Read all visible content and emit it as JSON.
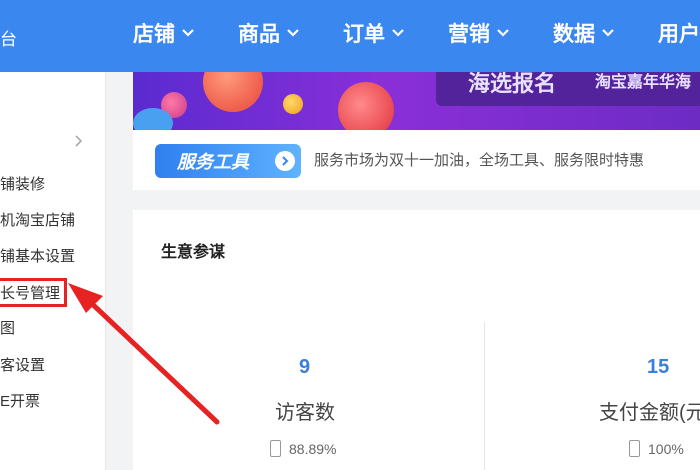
{
  "topnav": {
    "brand": "台",
    "items": [
      {
        "label": "店铺"
      },
      {
        "label": "商品"
      },
      {
        "label": "订单"
      },
      {
        "label": "营销"
      },
      {
        "label": "数据"
      },
      {
        "label": "用户"
      }
    ]
  },
  "sidebar": {
    "items": [
      {
        "label": "铺装修"
      },
      {
        "label": "机淘宝店铺"
      },
      {
        "label": "铺基本设置"
      },
      {
        "label": "长号管理"
      },
      {
        "label": "图"
      },
      {
        "label": "客设置"
      },
      {
        "label": "E开票"
      }
    ]
  },
  "banner": {
    "title": "海选报名",
    "subtitle": "淘宝嘉年华海"
  },
  "service": {
    "tag_label": "服务工具",
    "description": "服务市场为双十一加油，全场工具、服务限时特惠"
  },
  "business": {
    "title": "生意参谋",
    "metrics": [
      {
        "value": "9",
        "label": "访客数",
        "sub": "88.89%"
      },
      {
        "value": "15",
        "label": "支付金额(元",
        "sub": "100%"
      }
    ]
  },
  "colors": {
    "nav_bg": "#3a87f0",
    "highlight_border": "#e62222",
    "metric_value": "#3a7fd9"
  }
}
